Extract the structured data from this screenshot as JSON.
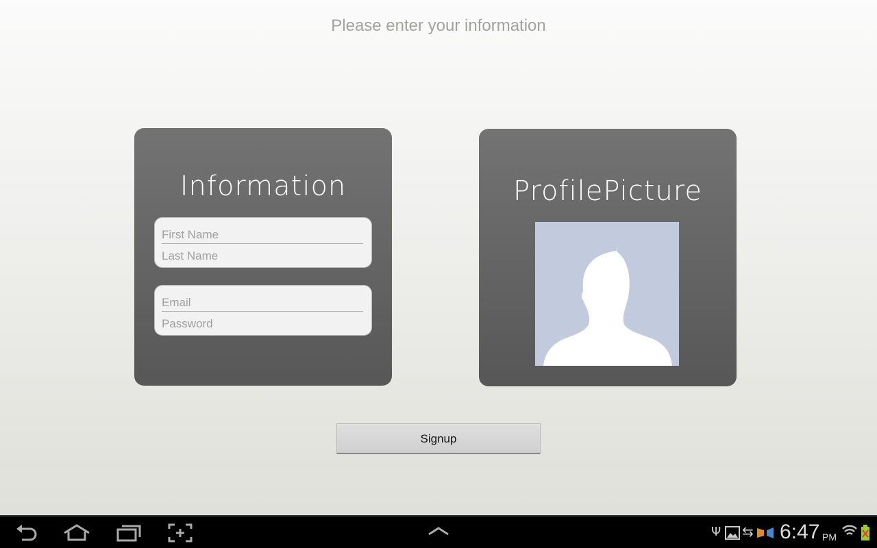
{
  "header": {
    "title": "Please enter your information"
  },
  "info_card": {
    "title": "Information",
    "first_name_placeholder": "First Name",
    "last_name_placeholder": "Last Name",
    "email_placeholder": "Email",
    "password_placeholder": "Password"
  },
  "profile_card": {
    "title": "ProfilePicture"
  },
  "signup_label": "Signup",
  "status_bar": {
    "time": "6:47",
    "ampm": "PM",
    "icons": [
      "usb-icon",
      "image-icon",
      "sync-icon",
      "media-icon",
      "wifi-icon",
      "battery-icon"
    ]
  },
  "nav_bar": {
    "icons": [
      "back-icon",
      "home-icon",
      "recent-apps-icon",
      "screenshot-icon",
      "up-chevron-icon"
    ]
  }
}
